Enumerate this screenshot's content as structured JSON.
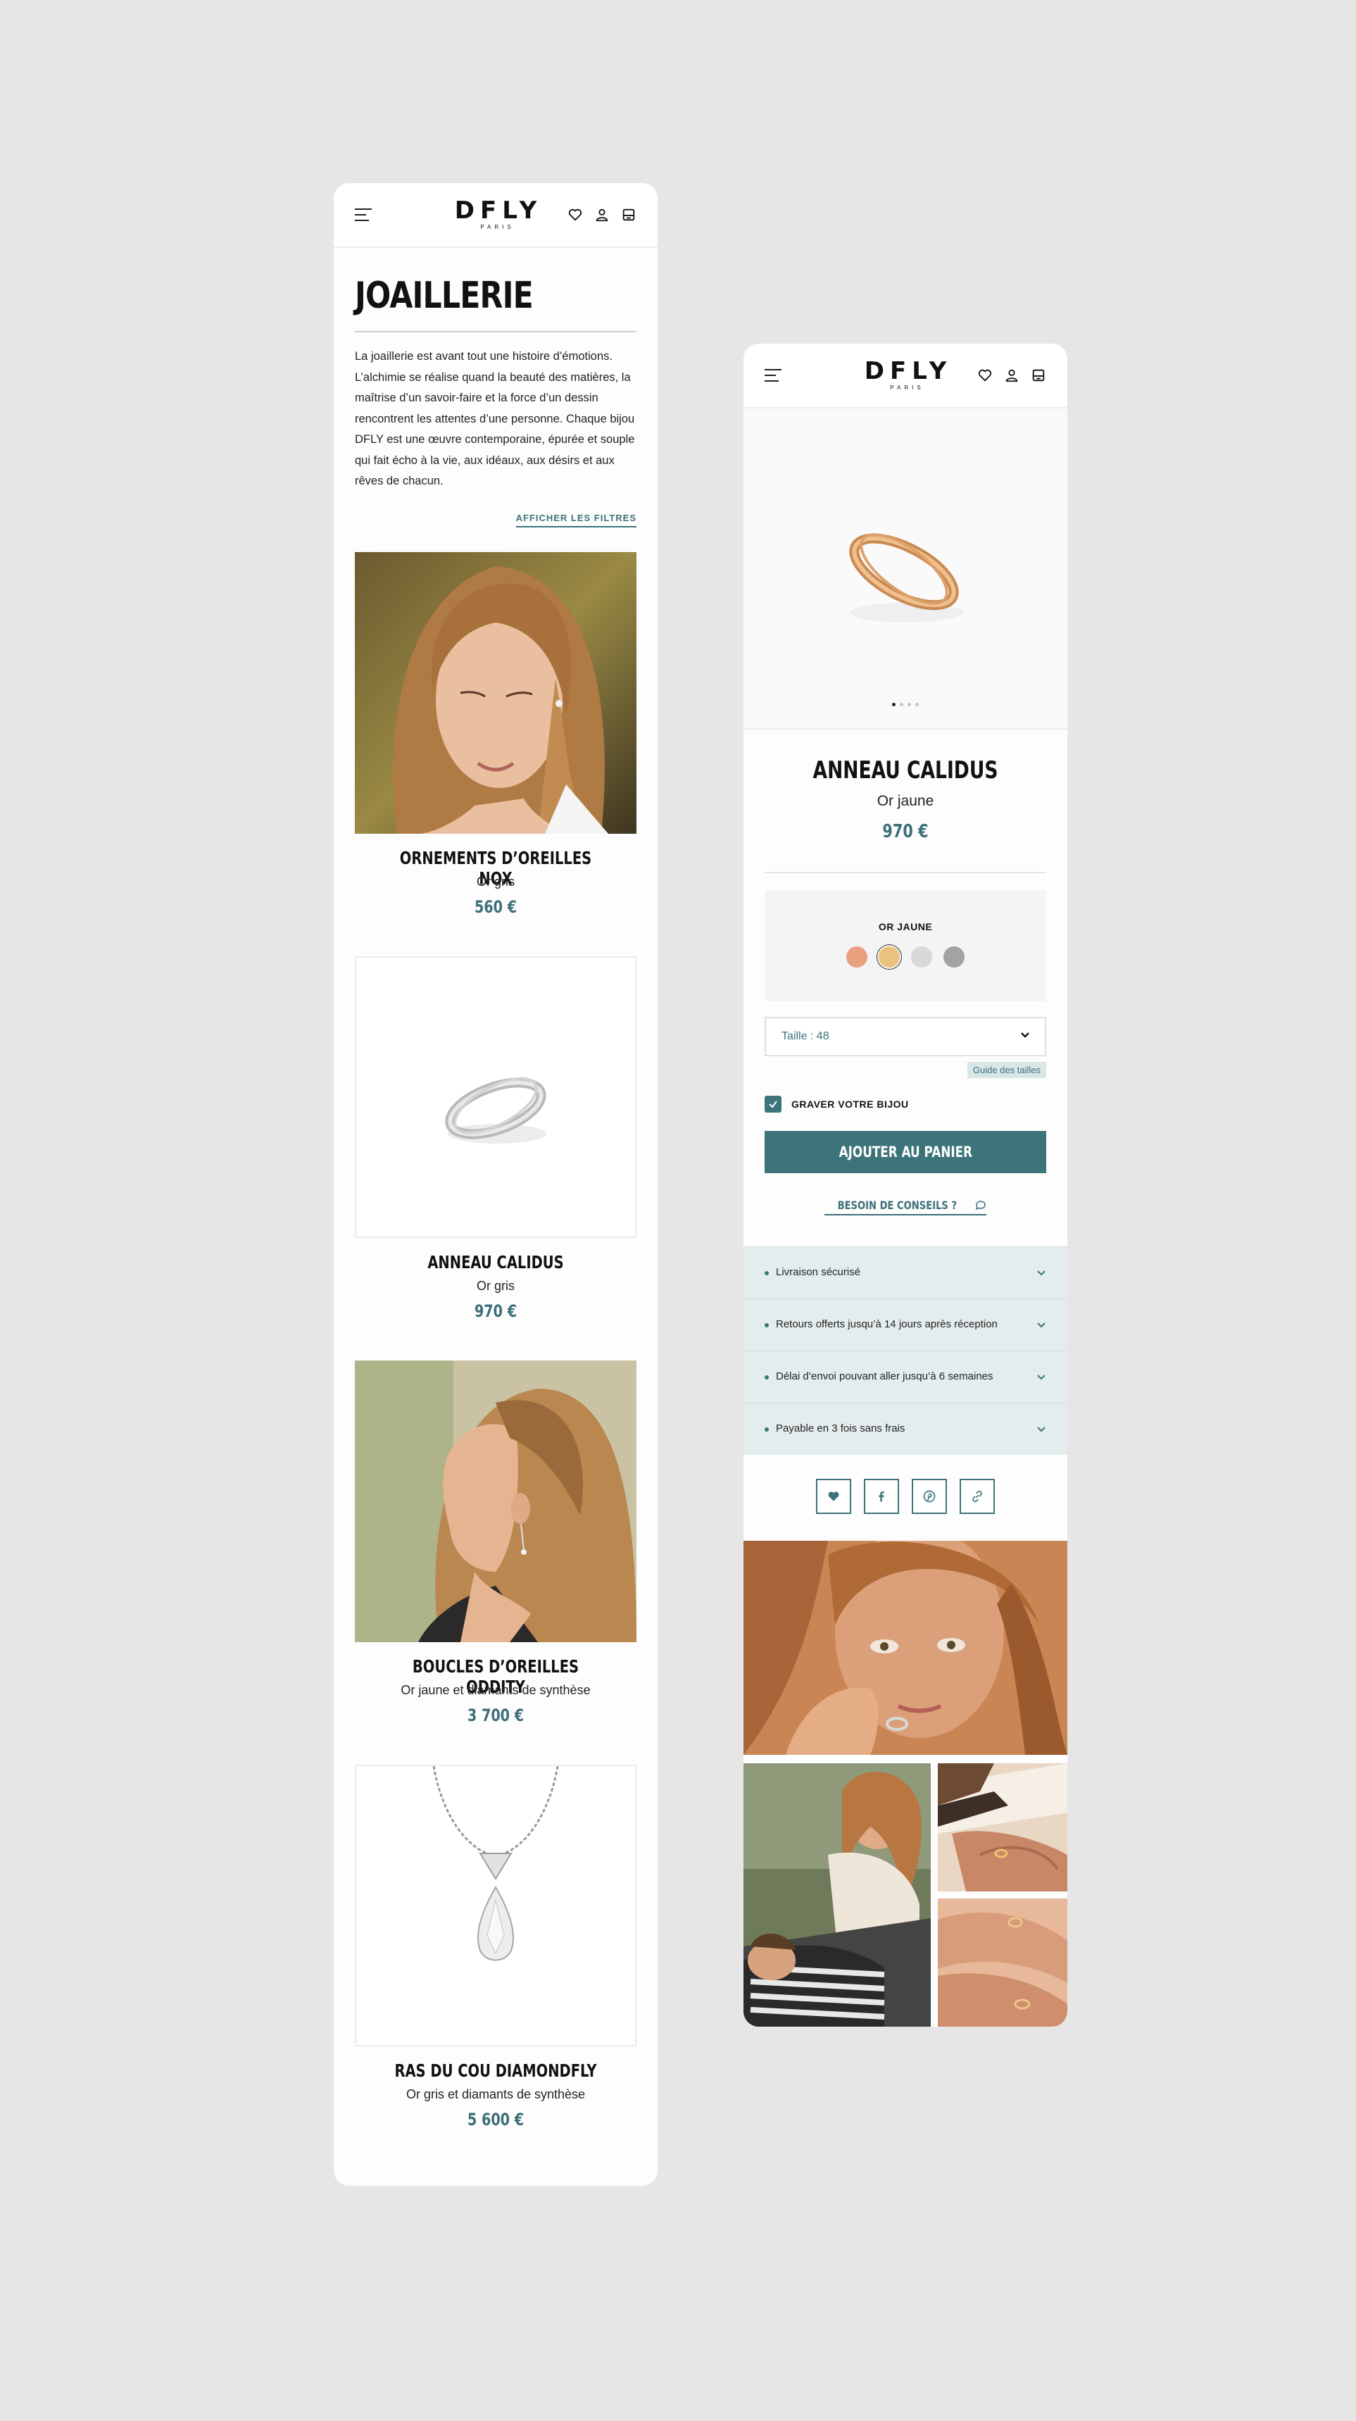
{
  "brand": {
    "wordmark": "DFLY",
    "tagline": "PARIS"
  },
  "header_icons": [
    "menu-icon",
    "heart-icon",
    "user-icon",
    "bag-icon"
  ],
  "listing": {
    "title": "JOAILLERIE",
    "intro": "La joaillerie est avant tout une histoire d’émotions. L’alchimie se réalise quand la beauté des matières, la maîtrise d’un savoir-faire et la force d’un dessin rencontrent les attentes d’une personne. Chaque bijou DFLY est une œuvre contemporaine, épurée et souple qui fait écho à la vie, aux idéaux, aux désirs et aux rêves de chacun.",
    "filters_label": "AFFICHER LES FILTRES",
    "products": [
      {
        "name": "ORNEMENTS D’OREILLES NOX",
        "variant": "Or gris",
        "price": "560 €"
      },
      {
        "name": "ANNEAU CALIDUS",
        "variant": "Or gris",
        "price": "970 €"
      },
      {
        "name": "BOUCLES D’OREILLES ODDITY",
        "variant": "Or jaune et diamants de synthèse",
        "price": "3 700 €"
      },
      {
        "name": "RAS DU COU DIAMONDFLY",
        "variant": "Or gris et diamants de synthèse",
        "price": "5 600 €"
      }
    ]
  },
  "product": {
    "name": "ANNEAU CALIDUS",
    "variant": "Or jaune",
    "price": "970 €",
    "gallery_dots": 4,
    "color_label": "OR JAUNE",
    "swatches": [
      "#e9a07f",
      "#eac27e",
      "#d8d8d8",
      "#a3a3a3"
    ],
    "selected_swatch": 1,
    "size_select": "Taille : 48",
    "size_guide": "Guide des tailles",
    "engrave_label": "GRAVER VOTRE BIJOU",
    "add_to_cart": "AJOUTER AU PANIER",
    "advice_link": "BESOIN DE CONSEILS ?",
    "accordion": [
      "Livraison sécurisé",
      "Retours offerts jusqu’à 14 jours après réception",
      "Délai d’envoi pouvant aller jusqu’à 6 semaines",
      "Payable en 3 fois sans frais"
    ],
    "share_icons": [
      "heart-icon",
      "facebook-icon",
      "pinterest-icon",
      "link-icon"
    ]
  },
  "colors": {
    "accent": "#3c7479",
    "price": "#3c6f79",
    "background": "#e6e6e6",
    "panel": "#e4eded"
  }
}
